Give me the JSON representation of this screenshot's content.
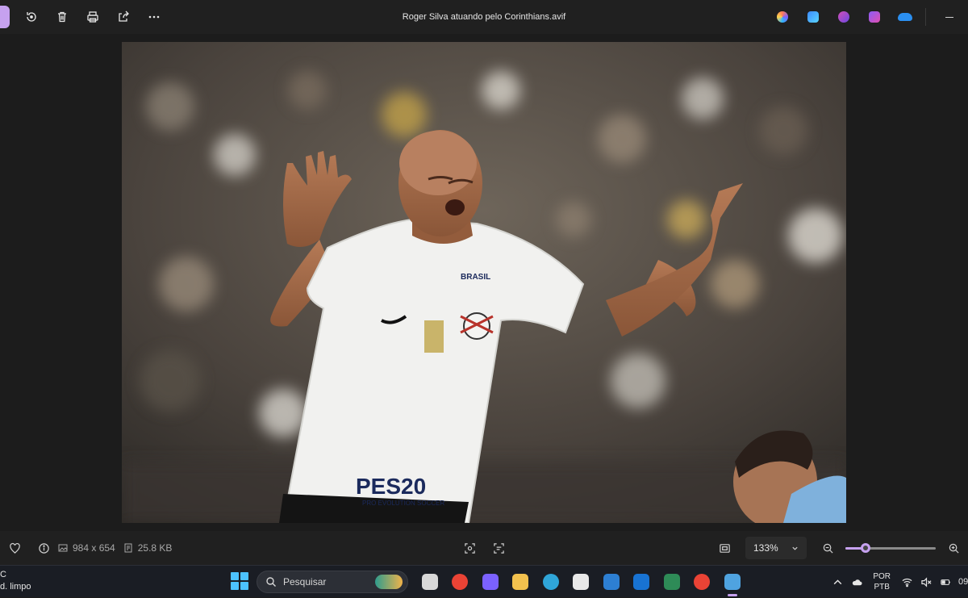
{
  "window": {
    "title": "Roger Silva atuando pelo Corinthians.avif"
  },
  "toolbar": {
    "icons": [
      "edit-icon",
      "rotate-icon",
      "delete-icon",
      "print-icon",
      "share-icon",
      "more-icon"
    ],
    "app_icons": [
      {
        "name": "copilot-icon",
        "color": "#7b61ff"
      },
      {
        "name": "designer-icon",
        "color": "#3d8bff"
      },
      {
        "name": "clipchamp-icon",
        "color": "#d14fb8"
      },
      {
        "name": "video-editor-icon",
        "color": "#8a5cf6"
      },
      {
        "name": "onedrive-icon",
        "color": "#2b8ff0"
      }
    ]
  },
  "photo": {
    "subject": "Roger Silva",
    "shirt_text": "PES20",
    "shirt_subtext": "PRO EVOLUTION SOCCER",
    "sponsor_text": "BRASIL"
  },
  "infobar": {
    "dimensions": "984 x 654",
    "file_size": "25.8 KB",
    "zoom": "133%",
    "zoom_level": 0.22
  },
  "taskbar": {
    "weather_line1": "C",
    "weather_line2": "d. limpo",
    "search_placeholder": "Pesquisar",
    "apps": [
      {
        "name": "task-view-icon",
        "color": "#d8d8d8"
      },
      {
        "name": "chrome-icon",
        "color": "#ea4335"
      },
      {
        "name": "copilot-app-icon",
        "color": "#7b61ff"
      },
      {
        "name": "file-explorer-icon",
        "color": "#f2c14e"
      },
      {
        "name": "edge-icon",
        "color": "#2fa5d8"
      },
      {
        "name": "store-icon",
        "color": "#e8e8e8"
      },
      {
        "name": "dell-icon",
        "color": "#2d7fd3"
      },
      {
        "name": "outlook-icon",
        "color": "#1873d3"
      },
      {
        "name": "solitaire-icon",
        "color": "#2e8b57"
      },
      {
        "name": "chrome-profile-icon",
        "color": "#ea4335"
      },
      {
        "name": "photos-icon",
        "color": "#4fa3e0"
      }
    ],
    "lang_line1": "POR",
    "lang_line2": "PTB",
    "clock": "09"
  },
  "colors": {
    "accent": "#c6a1ef",
    "background": "#1c1c1c",
    "bar": "#202020"
  }
}
